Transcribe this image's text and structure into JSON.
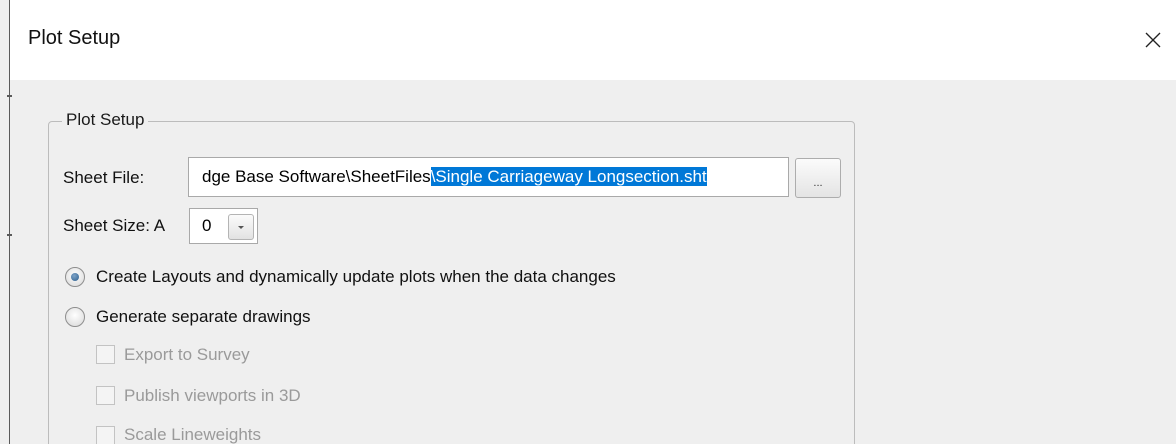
{
  "window": {
    "title": "Plot Setup",
    "close_icon": "close-icon"
  },
  "group": {
    "legend": "Plot Setup"
  },
  "sheet_file": {
    "label": "Sheet File:",
    "value_plain": "dge Base Software\\SheetFiles",
    "value_selected": "\\Single Carriageway Longsection.sht",
    "browse_label": "..."
  },
  "sheet_size": {
    "label": "Sheet Size: A",
    "value": "0",
    "dropdown_icon": "chevron-down-icon"
  },
  "options": {
    "create_layouts": {
      "label": "Create Layouts and dynamically update plots when the data changes",
      "selected": true
    },
    "separate_drawings": {
      "label": "Generate separate drawings",
      "selected": false
    }
  },
  "sub_options": {
    "export_survey": {
      "label": "Export to Survey",
      "checked": false,
      "enabled": false
    },
    "publish_3d": {
      "label": "Publish viewports in 3D",
      "checked": false,
      "enabled": false
    },
    "scale_lineweights": {
      "label": "Scale Lineweights",
      "checked": false,
      "enabled": false
    }
  },
  "colors": {
    "selection": "#0078d7",
    "background": "#efefef",
    "titlebar": "#ffffff",
    "disabled_text": "#9a9a9a"
  }
}
